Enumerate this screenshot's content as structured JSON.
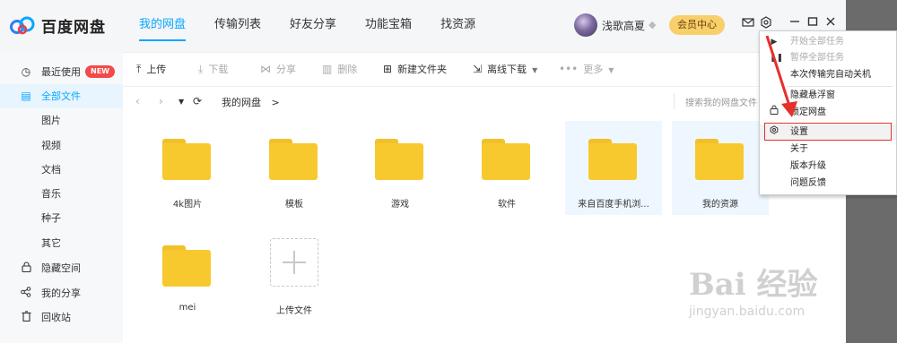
{
  "app": {
    "name": "百度网盘"
  },
  "nav": {
    "tabs": [
      "我的网盘",
      "传输列表",
      "好友分享",
      "功能宝箱",
      "找资源"
    ]
  },
  "user": {
    "name": "浅歌高夏",
    "vip_label": "会员中心"
  },
  "sidebar": {
    "items": [
      {
        "label": "最近使用",
        "badge": "NEW"
      },
      {
        "label": "全部文件"
      },
      {
        "label": "图片"
      },
      {
        "label": "视频"
      },
      {
        "label": "文档"
      },
      {
        "label": "音乐"
      },
      {
        "label": "种子"
      },
      {
        "label": "其它"
      },
      {
        "label": "隐藏空间"
      },
      {
        "label": "我的分享"
      },
      {
        "label": "回收站"
      }
    ]
  },
  "toolbar": {
    "upload": "上传",
    "download": "下载",
    "share": "分享",
    "delete": "删除",
    "new_folder": "新建文件夹",
    "offline": "离线下载",
    "more": "更多"
  },
  "path": {
    "crumb": "我的网盘",
    "sep": ">",
    "search_placeholder": "搜索我的网盘文件"
  },
  "files": [
    {
      "name": "4k图片"
    },
    {
      "name": "模板"
    },
    {
      "name": "游戏"
    },
    {
      "name": "软件"
    },
    {
      "name": "来自百度手机浏..."
    },
    {
      "name": "我的资源"
    },
    {
      "name": "mei"
    },
    {
      "name": "上传文件"
    }
  ],
  "menu": {
    "items": [
      {
        "label": "开始全部任务"
      },
      {
        "label": "暂停全部任务"
      },
      {
        "label": "本次传输完自动关机"
      },
      {
        "label": "隐藏悬浮窗"
      },
      {
        "label": "锁定网盘"
      },
      {
        "label": "设置"
      },
      {
        "label": "关于"
      },
      {
        "label": "版本升级"
      },
      {
        "label": "问题反馈"
      }
    ]
  },
  "watermark": {
    "main": "Bai 经验",
    "sub": "jingyan.baidu.com"
  }
}
